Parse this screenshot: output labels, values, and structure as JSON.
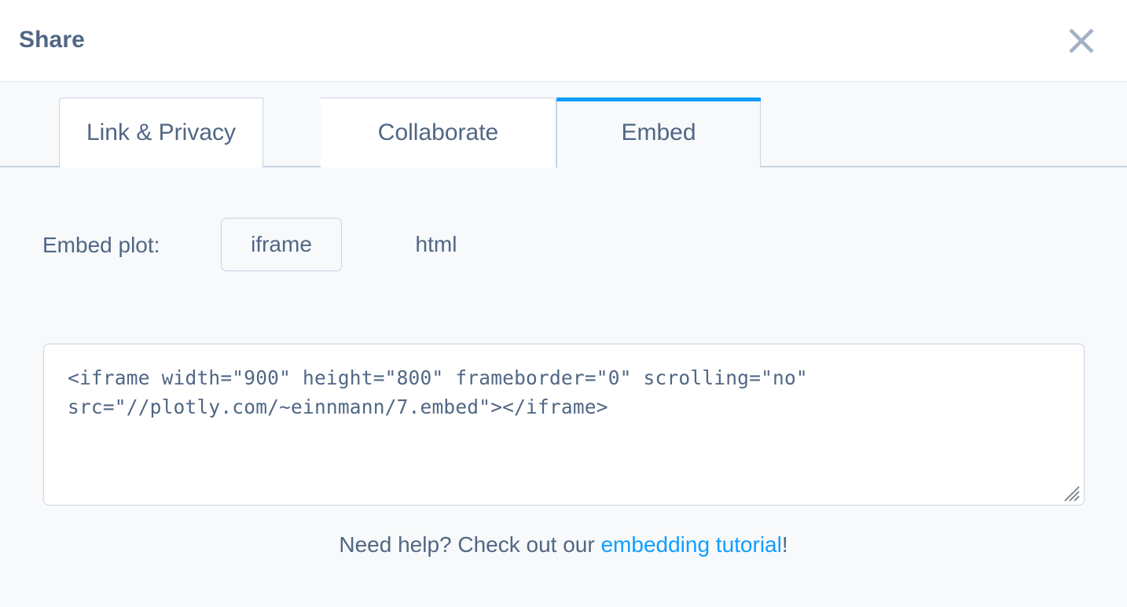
{
  "dialog": {
    "title": "Share",
    "close_icon": "close-icon"
  },
  "tabs": [
    {
      "label": "Link & Privacy",
      "active": false
    },
    {
      "label": "Collaborate",
      "active": false
    },
    {
      "label": "Embed",
      "active": true
    }
  ],
  "embed": {
    "format_label": "Embed plot:",
    "formats": [
      {
        "label": "iframe",
        "selected": true
      },
      {
        "label": "html",
        "selected": false
      }
    ],
    "code": "<iframe width=\"900\" height=\"800\" frameborder=\"0\" scrolling=\"no\" src=\"//plotly.com/~einnmann/7.embed\"></iframe>",
    "resize_handle_icon": "resize-grip-icon"
  },
  "help": {
    "prefix": "Need help? Check out our ",
    "link_text": "embedding tutorial",
    "suffix": "!"
  },
  "colors": {
    "accent_blue": "#119dff",
    "text_slate": "#506784",
    "border_light": "#c8d4e3",
    "panel_bg": "#f7f9fb",
    "header_bg": "#ffffff",
    "close_icon": "#a2b1c6"
  }
}
